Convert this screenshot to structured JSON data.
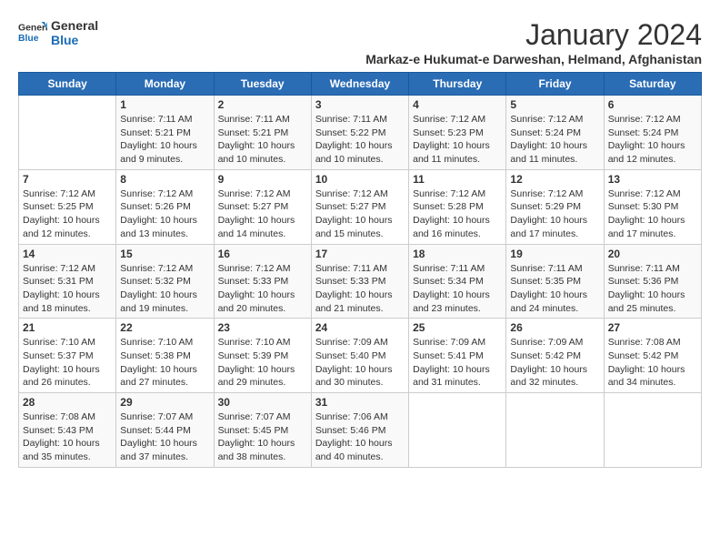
{
  "logo": {
    "line1": "General",
    "line2": "Blue"
  },
  "title": "January 2024",
  "subtitle": "Markaz-e Hukumat-e Darweshan, Helmand, Afghanistan",
  "weekdays": [
    "Sunday",
    "Monday",
    "Tuesday",
    "Wednesday",
    "Thursday",
    "Friday",
    "Saturday"
  ],
  "days": [
    {
      "num": "",
      "info": ""
    },
    {
      "num": "1",
      "info": "Sunrise: 7:11 AM\nSunset: 5:21 PM\nDaylight: 10 hours\nand 9 minutes."
    },
    {
      "num": "2",
      "info": "Sunrise: 7:11 AM\nSunset: 5:21 PM\nDaylight: 10 hours\nand 10 minutes."
    },
    {
      "num": "3",
      "info": "Sunrise: 7:11 AM\nSunset: 5:22 PM\nDaylight: 10 hours\nand 10 minutes."
    },
    {
      "num": "4",
      "info": "Sunrise: 7:12 AM\nSunset: 5:23 PM\nDaylight: 10 hours\nand 11 minutes."
    },
    {
      "num": "5",
      "info": "Sunrise: 7:12 AM\nSunset: 5:24 PM\nDaylight: 10 hours\nand 11 minutes."
    },
    {
      "num": "6",
      "info": "Sunrise: 7:12 AM\nSunset: 5:24 PM\nDaylight: 10 hours\nand 12 minutes."
    },
    {
      "num": "7",
      "info": "Sunrise: 7:12 AM\nSunset: 5:25 PM\nDaylight: 10 hours\nand 12 minutes."
    },
    {
      "num": "8",
      "info": "Sunrise: 7:12 AM\nSunset: 5:26 PM\nDaylight: 10 hours\nand 13 minutes."
    },
    {
      "num": "9",
      "info": "Sunrise: 7:12 AM\nSunset: 5:27 PM\nDaylight: 10 hours\nand 14 minutes."
    },
    {
      "num": "10",
      "info": "Sunrise: 7:12 AM\nSunset: 5:27 PM\nDaylight: 10 hours\nand 15 minutes."
    },
    {
      "num": "11",
      "info": "Sunrise: 7:12 AM\nSunset: 5:28 PM\nDaylight: 10 hours\nand 16 minutes."
    },
    {
      "num": "12",
      "info": "Sunrise: 7:12 AM\nSunset: 5:29 PM\nDaylight: 10 hours\nand 17 minutes."
    },
    {
      "num": "13",
      "info": "Sunrise: 7:12 AM\nSunset: 5:30 PM\nDaylight: 10 hours\nand 17 minutes."
    },
    {
      "num": "14",
      "info": "Sunrise: 7:12 AM\nSunset: 5:31 PM\nDaylight: 10 hours\nand 18 minutes."
    },
    {
      "num": "15",
      "info": "Sunrise: 7:12 AM\nSunset: 5:32 PM\nDaylight: 10 hours\nand 19 minutes."
    },
    {
      "num": "16",
      "info": "Sunrise: 7:12 AM\nSunset: 5:33 PM\nDaylight: 10 hours\nand 20 minutes."
    },
    {
      "num": "17",
      "info": "Sunrise: 7:11 AM\nSunset: 5:33 PM\nDaylight: 10 hours\nand 21 minutes."
    },
    {
      "num": "18",
      "info": "Sunrise: 7:11 AM\nSunset: 5:34 PM\nDaylight: 10 hours\nand 23 minutes."
    },
    {
      "num": "19",
      "info": "Sunrise: 7:11 AM\nSunset: 5:35 PM\nDaylight: 10 hours\nand 24 minutes."
    },
    {
      "num": "20",
      "info": "Sunrise: 7:11 AM\nSunset: 5:36 PM\nDaylight: 10 hours\nand 25 minutes."
    },
    {
      "num": "21",
      "info": "Sunrise: 7:10 AM\nSunset: 5:37 PM\nDaylight: 10 hours\nand 26 minutes."
    },
    {
      "num": "22",
      "info": "Sunrise: 7:10 AM\nSunset: 5:38 PM\nDaylight: 10 hours\nand 27 minutes."
    },
    {
      "num": "23",
      "info": "Sunrise: 7:10 AM\nSunset: 5:39 PM\nDaylight: 10 hours\nand 29 minutes."
    },
    {
      "num": "24",
      "info": "Sunrise: 7:09 AM\nSunset: 5:40 PM\nDaylight: 10 hours\nand 30 minutes."
    },
    {
      "num": "25",
      "info": "Sunrise: 7:09 AM\nSunset: 5:41 PM\nDaylight: 10 hours\nand 31 minutes."
    },
    {
      "num": "26",
      "info": "Sunrise: 7:09 AM\nSunset: 5:42 PM\nDaylight: 10 hours\nand 32 minutes."
    },
    {
      "num": "27",
      "info": "Sunrise: 7:08 AM\nSunset: 5:42 PM\nDaylight: 10 hours\nand 34 minutes."
    },
    {
      "num": "28",
      "info": "Sunrise: 7:08 AM\nSunset: 5:43 PM\nDaylight: 10 hours\nand 35 minutes."
    },
    {
      "num": "29",
      "info": "Sunrise: 7:07 AM\nSunset: 5:44 PM\nDaylight: 10 hours\nand 37 minutes."
    },
    {
      "num": "30",
      "info": "Sunrise: 7:07 AM\nSunset: 5:45 PM\nDaylight: 10 hours\nand 38 minutes."
    },
    {
      "num": "31",
      "info": "Sunrise: 7:06 AM\nSunset: 5:46 PM\nDaylight: 10 hours\nand 40 minutes."
    },
    {
      "num": "",
      "info": ""
    },
    {
      "num": "",
      "info": ""
    },
    {
      "num": "",
      "info": ""
    },
    {
      "num": "",
      "info": ""
    }
  ]
}
